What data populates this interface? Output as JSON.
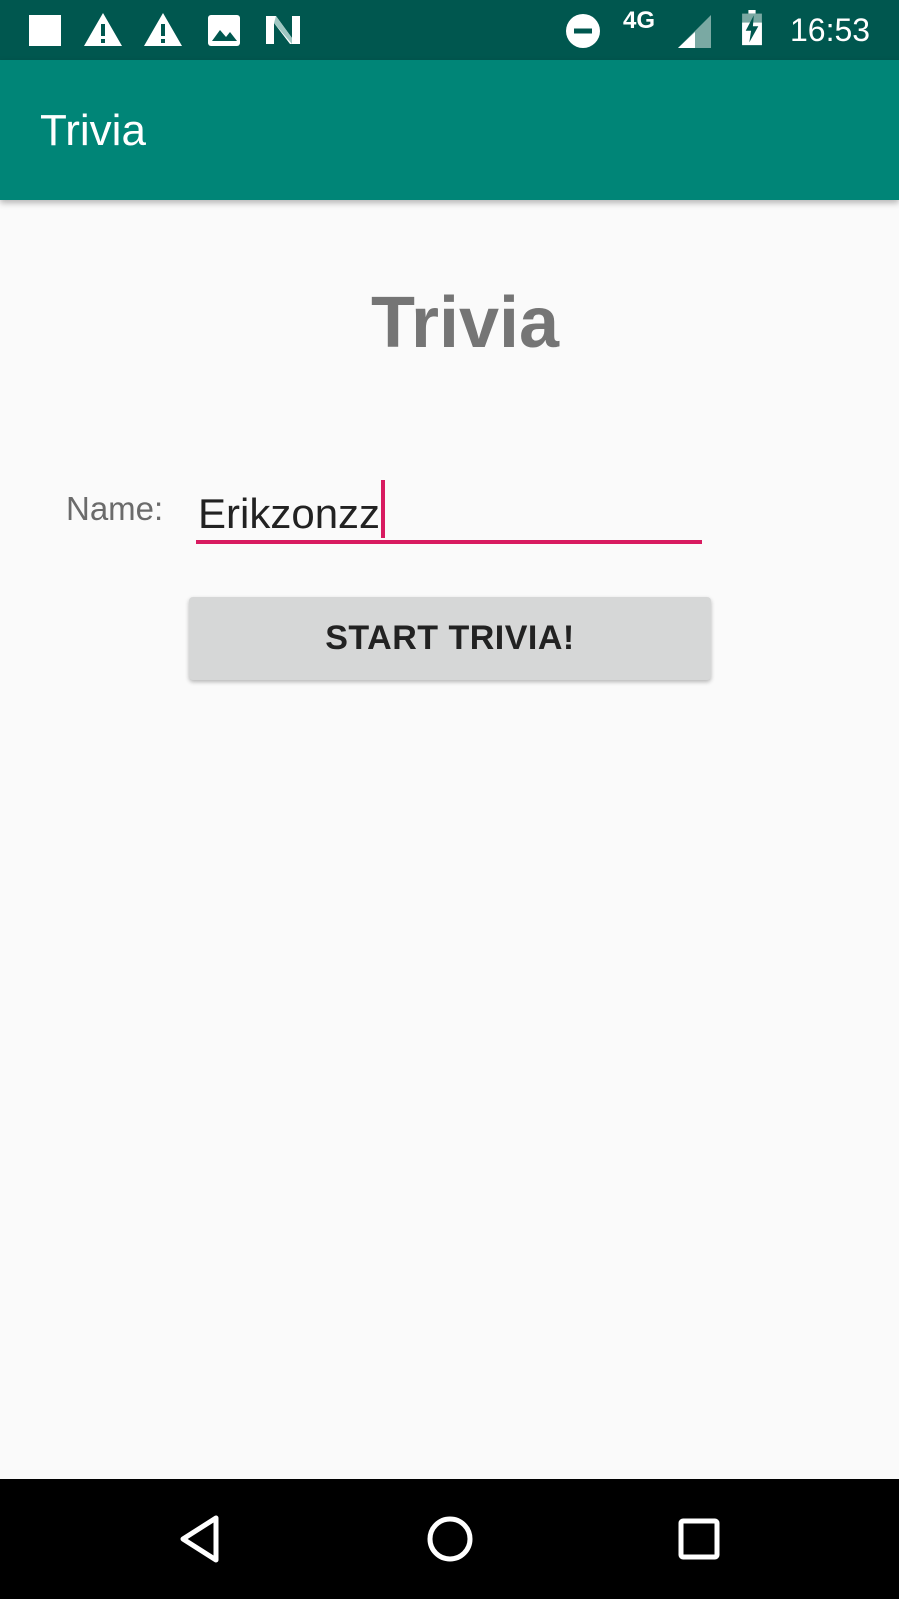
{
  "status_bar": {
    "time": "16:53",
    "network": "4G",
    "notification_icons": [
      "stop-icon",
      "warning-icon",
      "warning-icon",
      "image-icon",
      "n-icon"
    ],
    "right_icons": [
      "do-not-disturb-icon",
      "signal-icon",
      "battery-charging-icon"
    ]
  },
  "app_bar": {
    "title": "Trivia"
  },
  "main": {
    "heading": "Trivia",
    "name_label": "Name:",
    "name_value": "Erikzonzz",
    "start_button": "START TRIVIA!"
  },
  "nav_bar": {
    "icons": [
      "back-icon",
      "home-icon",
      "recents-icon"
    ]
  },
  "colors": {
    "status_bar": "#00574f",
    "app_bar": "#008577",
    "accent": "#d81b60",
    "background": "#fafafa",
    "button": "#d6d7d7"
  }
}
